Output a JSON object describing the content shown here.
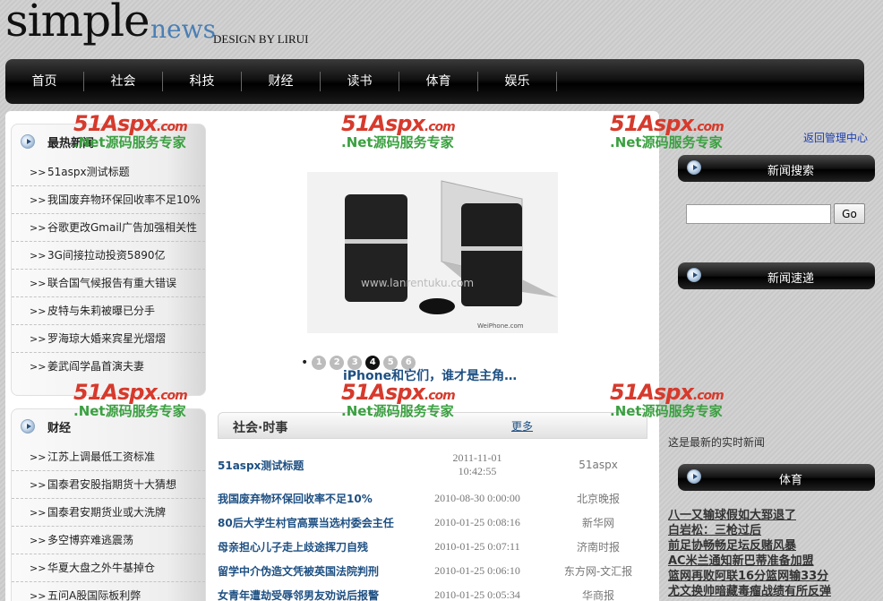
{
  "header": {
    "logo_simple": "simple",
    "logo_news": "news",
    "design_by": "DESIGN BY LIRUI"
  },
  "nav": {
    "items": [
      "首页",
      "社会",
      "科技",
      "财经",
      "读书",
      "体育",
      "娱乐"
    ]
  },
  "hot_news": {
    "title": "最热新闻",
    "items": [
      "51aspx测试标题",
      "我国废弃物环保回收率不足10%",
      "谷歌更改Gmail广告加强相关性",
      "3G间接拉动投资5890亿",
      "联合国气候报告有重大错误",
      "皮特与朱莉被曝已分手",
      "罗海琼大婚来宾星光熠熠",
      "姜武阎学晶首演夫妻"
    ]
  },
  "finance": {
    "title": "财经",
    "items": [
      "江苏上调最低工资标准",
      "国泰君安股指期货十大猜想",
      "国泰君安期货业或大洗牌",
      "多空博弈难逃震荡",
      "华夏大盘之外牛基掉仓",
      "五问A股国际板利弊"
    ]
  },
  "watermark": {
    "brand": "51Aspx",
    "domain": ".com",
    "slogan": ".Net源码服务专家"
  },
  "slideshow": {
    "dots": [
      "1",
      "2",
      "3",
      "4",
      "5",
      "6"
    ],
    "active_index": 4,
    "caption": "iPhone和它们，谁才是主角…",
    "image_watermark": "www.lanrentuku.com",
    "image_brand": "WeiPhone.com"
  },
  "society": {
    "title": "社会·时事",
    "more": "更多",
    "rows": [
      {
        "title": "51aspx测试标题",
        "date": "2011-11-01",
        "time": "10:42:55",
        "source": "51aspx"
      },
      {
        "title": "我国废弃物环保回收率不足10%",
        "date": "2010-08-30 0:00:00",
        "source": "北京晚报"
      },
      {
        "title": "80后大学生村官高票当选村委会主任",
        "date": "2010-01-25 0:08:16",
        "source": "新华网"
      },
      {
        "title": "母亲担心儿子走上歧途挥刀自残",
        "date": "2010-01-25 0:07:11",
        "source": "济南时报"
      },
      {
        "title": "留学中介伪造文凭被英国法院判刑",
        "date": "2010-01-25 0:06:10",
        "source": "东方网-文汇报"
      },
      {
        "title": "女青年遭劫受辱邻男友劝说后报警",
        "date": "2010-01-25 0:05:34",
        "source": "华商报"
      }
    ]
  },
  "right": {
    "back_link": "返回管理中心",
    "search_title": "新闻搜索",
    "search_button": "Go",
    "search_value": "",
    "latest_title": "新闻速递",
    "latest_text": "这是最新的实时新闻",
    "sports_title": "体育",
    "sports_items": [
      "八一又输球假如大郅退了",
      "白岩松：三枪过后",
      "前足协畅畅足坛反赌风暴",
      "AC米兰通知新巴蒂准备加盟",
      "篮网再败阿联16分篮网输33分",
      "尤文换帅暗藏毒瘤战绩有所反弹"
    ]
  }
}
